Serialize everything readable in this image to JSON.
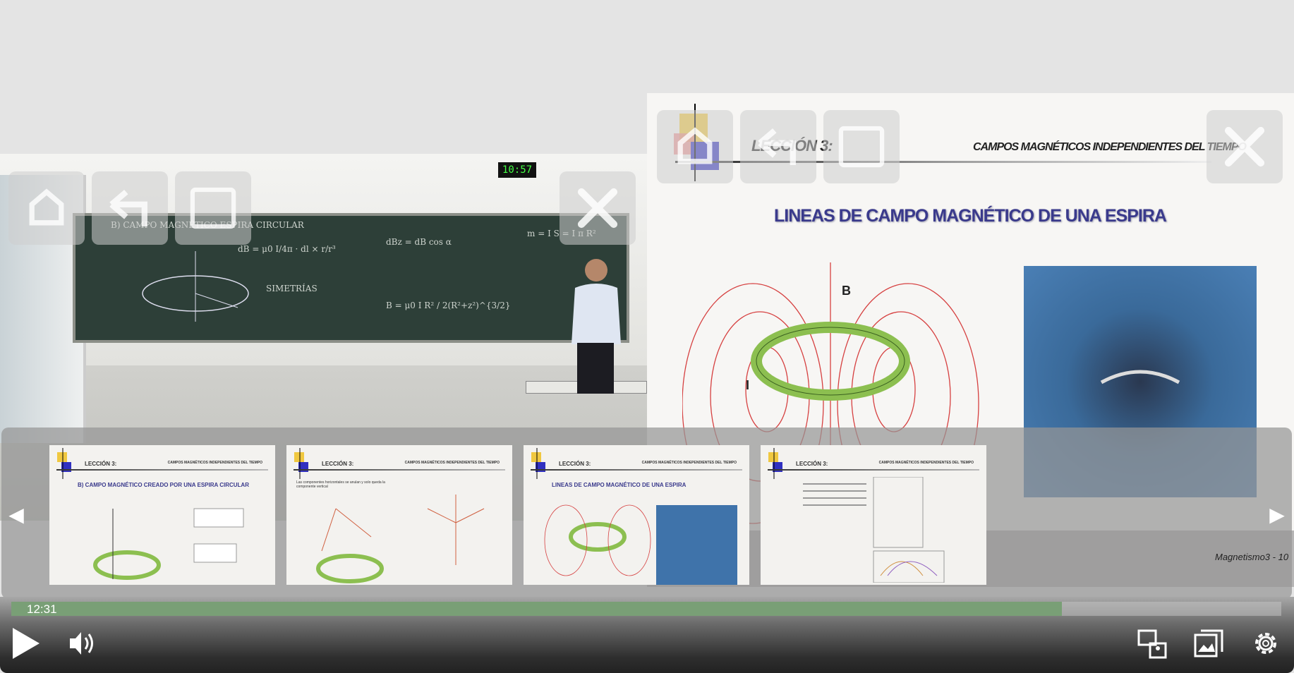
{
  "video": {
    "wall_clock": "10:57",
    "board_text": [
      "B) CAMPO MAGNÉTICO ESPIRA CIRCULAR",
      "dB = μ0 I/4π · dl × r/r³",
      "dBz = dB cos α",
      "m = I S = I π R²",
      "B = μ0 I R² / 2(R²+z²)^{3/2}",
      "SIMETRÍAS"
    ]
  },
  "slide": {
    "lesson": "LECCIÓN 3:",
    "topic": "CAMPOS MAGNÉTICOS INDEPENDIENTES DEL TIEMPO",
    "title": "LINEAS DE CAMPO MAGNÉTICO DE UNA ESPIRA",
    "label_B": "B",
    "label_I": "I",
    "page": "Magnetismo3 - 10"
  },
  "thumbnails": [
    {
      "lesson": "LECCIÓN 3:",
      "topic": "CAMPOS MAGNÉTICOS INDEPENDIENTES DEL TIEMPO",
      "title": "B) CAMPO MAGNÉTICO CREADO POR UNA ESPIRA CIRCULAR"
    },
    {
      "lesson": "LECCIÓN 3:",
      "topic": "CAMPOS MAGNÉTICOS INDEPENDIENTES DEL TIEMPO",
      "title": "Las componentes horizontales se anulan y solo queda la componente vertical"
    },
    {
      "lesson": "LECCIÓN 3:",
      "topic": "CAMPOS MAGNÉTICOS INDEPENDIENTES DEL TIEMPO",
      "title": "LINEAS DE CAMPO MAGNÉTICO DE UNA ESPIRA"
    },
    {
      "lesson": "LECCIÓN 3:",
      "topic": "CAMPOS MAGNÉTICOS INDEPENDIENTES DEL TIEMPO",
      "title": ""
    }
  ],
  "player": {
    "current_time": "12:31",
    "progress_fraction": 0.827,
    "progress_color": "#799f76"
  },
  "icons": {
    "play": "play-icon",
    "volume": "volume-icon",
    "layout": "layout-switch-icon",
    "slides": "slides-icon",
    "settings": "gear-icon"
  }
}
